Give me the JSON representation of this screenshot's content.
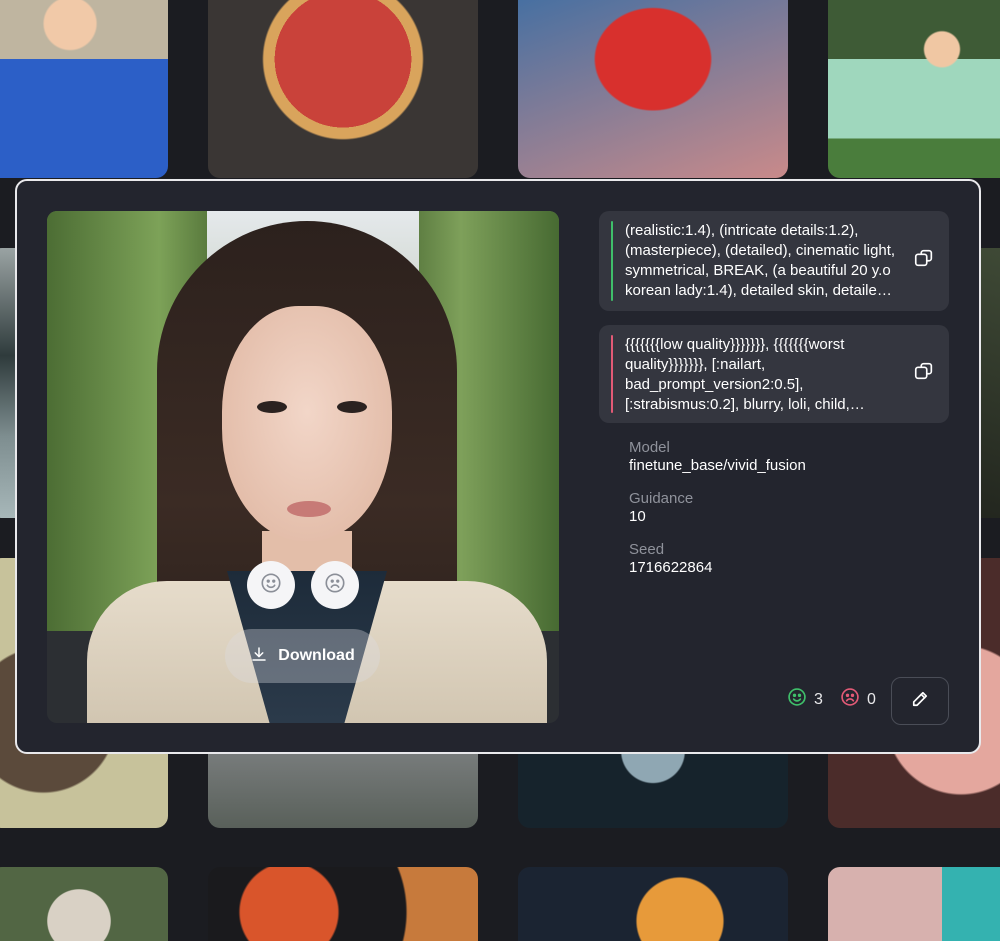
{
  "modal": {
    "download_label": "Download",
    "positive_prompt": "(realistic:1.4), (intricate details:1.2), (masterpiece), (detailed), cinematic light, symmetrical, BREAK, (a beautiful 20 y.o korean lady:1.4), detailed skin, detailed face, hazel eyes",
    "negative_prompt": "{{{{{{{low quality}}}}}}}, {{{{{{{worst quality}}}}}}}, [:nailart, bad_prompt_version2:0.5], [:strabismus:0.2], blurry, loli, child, deformed",
    "model_label": "Model",
    "model_value": "finetune_base/vivid_fusion",
    "guidance_label": "Guidance",
    "guidance_value": "10",
    "seed_label": "Seed",
    "seed_value": "1716622864",
    "happy_count": "3",
    "sad_count": "0"
  },
  "colors": {
    "positive_bar": "#3fbf6a",
    "negative_bar": "#e25a76",
    "happy": "#3fbf6a",
    "sad": "#e25a76"
  },
  "icons": {
    "happy": "smile-icon",
    "sad": "frown-icon",
    "download": "download-icon",
    "copy": "copy-icon",
    "edit": "pencil-icon"
  }
}
